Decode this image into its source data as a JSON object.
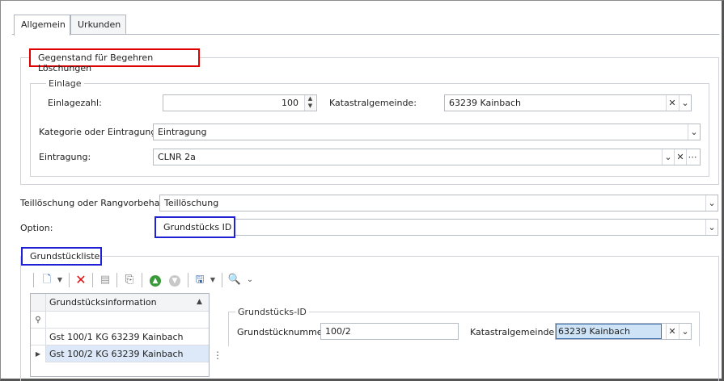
{
  "tabs": [
    {
      "label": "Allgemein"
    },
    {
      "label": "Urkunden"
    }
  ],
  "gegenstand": {
    "title": "Gegenstand für Begehren Löschungen",
    "einlage": {
      "title": "Einlage",
      "einlagezahl_label": "Einlagezahl:",
      "einlagezahl_value": "100",
      "katastralgemeinde_label": "Katastralgemeinde:",
      "katastralgemeinde_value": "63239 Kainbach"
    },
    "kategorie_label": "Kategorie oder Eintragung:",
    "kategorie_value": "Eintragung",
    "eintragung_label": "Eintragung:",
    "eintragung_value": "CLNR 2a"
  },
  "teilloeschung_label": "Teillöschung oder Rangvorbehalt:",
  "teilloeschung_value": "Teillöschung",
  "option_label": "Option:",
  "option_value": "Grundstücks ID",
  "grundstueckliste": {
    "title": "Grundstückliste",
    "toolbar_icons": [
      "new-document-icon",
      "delete-icon",
      "list-icon",
      "search-document-icon",
      "move-up-icon",
      "move-down-icon",
      "save-icon",
      "find-icon"
    ],
    "grid": {
      "column_header": "Grundstücksinformation",
      "filter_icon": "filter-pin-icon",
      "rows": [
        {
          "text": "Gst 100/1 KG 63239 Kainbach"
        },
        {
          "text": "Gst 100/2 KG 63239 Kainbach"
        }
      ]
    },
    "detail": {
      "title": "Grundstücks-ID",
      "grundstuecknummer_label": "Grundstücknummer:",
      "grundstuecknummer_value": "100/2",
      "katastralgemeinde_label": "Katastralgemeinde:",
      "katastralgemeinde_value": "63239 Kainbach"
    }
  },
  "colors": {
    "highlight_red": "#e00000",
    "highlight_blue": "#1f1fd6",
    "selected_row": "#dde9f8",
    "selected_field": "#cfe3f7"
  }
}
